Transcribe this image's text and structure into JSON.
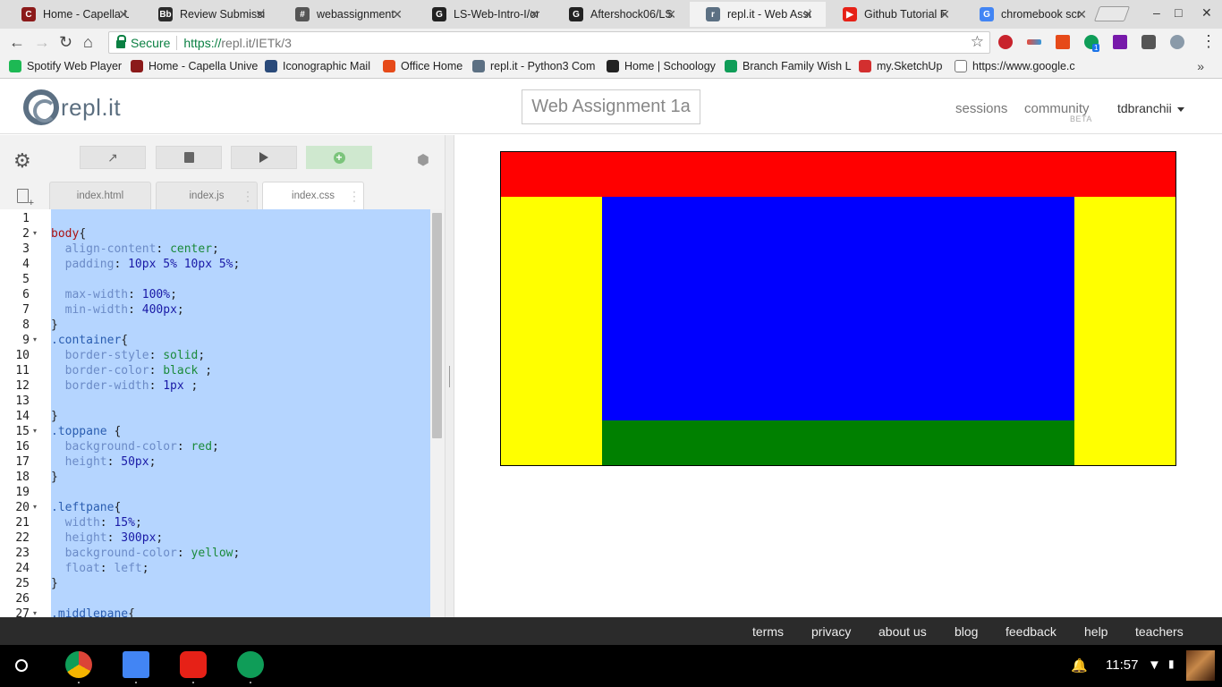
{
  "browser": {
    "tabs": [
      {
        "title": "Home - Capella U",
        "color": "#8b1a1a",
        "glyph": "C"
      },
      {
        "title": "Review Submissi",
        "color": "#2b2b2b",
        "glyph": "Bb"
      },
      {
        "title": "webassignment",
        "color": "#555555",
        "glyph": "#"
      },
      {
        "title": "LS-Web-Intro-I/or",
        "color": "#222222",
        "glyph": "G"
      },
      {
        "title": "Aftershock06/LS",
        "color": "#222222",
        "glyph": "G"
      },
      {
        "title": "repl.it - Web Assi",
        "color": "#5c7083",
        "glyph": "r"
      },
      {
        "title": "Github Tutorial F",
        "color": "#e62117",
        "glyph": "▶"
      },
      {
        "title": "chromebook scr",
        "color": "#4285f4",
        "glyph": "G"
      }
    ],
    "active_tab": 5,
    "address": {
      "secure_label": "Secure",
      "url_scheme": "https://",
      "url_rest": "repl.it/IETk/3"
    },
    "bookmarks": [
      {
        "label": "Spotify Web Player",
        "color": "#1db954"
      },
      {
        "label": "Home - Capella Unive",
        "color": "#8b1a1a"
      },
      {
        "label": "Iconographic Mail",
        "color": "#2a4a7a"
      },
      {
        "label": "Office Home",
        "color": "#e64a19"
      },
      {
        "label": "repl.it - Python3 Com",
        "color": "#5c7083"
      },
      {
        "label": "Home | Schoology",
        "color": "#222222"
      },
      {
        "label": "Branch Family Wish L",
        "color": "#0f9d58"
      },
      {
        "label": "my.SketchUp",
        "color": "#d32f2f"
      },
      {
        "label": "https://www.google.c",
        "color": "#ffffff"
      }
    ],
    "overflow_icon": "»",
    "extension_badge": "1"
  },
  "site": {
    "logo_text": "repl.it",
    "project_title": "Web Assignment 1a",
    "nav": {
      "sessions": "sessions",
      "community": "community",
      "community_badge": "BETA",
      "user": "tdbranchii"
    }
  },
  "editor": {
    "file_tabs": [
      "index.html",
      "index.js",
      "index.css"
    ],
    "active_file": 2,
    "lines": [
      {
        "n": "1",
        "fold": false,
        "tokens": []
      },
      {
        "n": "2",
        "fold": true,
        "tokens": [
          [
            "sel",
            "body"
          ],
          [
            "plain",
            "{"
          ]
        ]
      },
      {
        "n": "3",
        "fold": false,
        "tokens": [
          [
            "plain",
            "  "
          ],
          [
            "prop",
            "align-content"
          ],
          [
            "plain",
            ": "
          ],
          [
            "kw",
            "center"
          ],
          [
            "plain",
            ";"
          ]
        ]
      },
      {
        "n": "4",
        "fold": false,
        "tokens": [
          [
            "plain",
            "  "
          ],
          [
            "prop",
            "padding"
          ],
          [
            "plain",
            ": "
          ],
          [
            "num",
            "10px 5% 10px 5%"
          ],
          [
            "plain",
            ";"
          ]
        ]
      },
      {
        "n": "5",
        "fold": false,
        "tokens": []
      },
      {
        "n": "6",
        "fold": false,
        "tokens": [
          [
            "plain",
            "  "
          ],
          [
            "prop",
            "max-width"
          ],
          [
            "plain",
            ": "
          ],
          [
            "num",
            "100%"
          ],
          [
            "plain",
            ";"
          ]
        ]
      },
      {
        "n": "7",
        "fold": false,
        "tokens": [
          [
            "plain",
            "  "
          ],
          [
            "prop",
            "min-width"
          ],
          [
            "plain",
            ": "
          ],
          [
            "num",
            "400px"
          ],
          [
            "plain",
            ";"
          ]
        ]
      },
      {
        "n": "8",
        "fold": false,
        "tokens": [
          [
            "plain",
            "}"
          ]
        ]
      },
      {
        "n": "9",
        "fold": true,
        "tokens": [
          [
            "cls",
            ".container"
          ],
          [
            "plain",
            "{"
          ]
        ]
      },
      {
        "n": "10",
        "fold": false,
        "tokens": [
          [
            "plain",
            "  "
          ],
          [
            "prop",
            "border-style"
          ],
          [
            "plain",
            ": "
          ],
          [
            "kw",
            "solid"
          ],
          [
            "plain",
            ";"
          ]
        ]
      },
      {
        "n": "11",
        "fold": false,
        "tokens": [
          [
            "plain",
            "  "
          ],
          [
            "prop",
            "border-color"
          ],
          [
            "plain",
            ": "
          ],
          [
            "kw",
            "black"
          ],
          [
            "plain",
            " ;"
          ]
        ]
      },
      {
        "n": "12",
        "fold": false,
        "tokens": [
          [
            "plain",
            "  "
          ],
          [
            "prop",
            "border-width"
          ],
          [
            "plain",
            ": "
          ],
          [
            "num",
            "1px"
          ],
          [
            "plain",
            " ;"
          ]
        ]
      },
      {
        "n": "13",
        "fold": false,
        "tokens": []
      },
      {
        "n": "14",
        "fold": false,
        "tokens": [
          [
            "plain",
            "}"
          ]
        ]
      },
      {
        "n": "15",
        "fold": true,
        "tokens": [
          [
            "cls",
            ".toppane"
          ],
          [
            "plain",
            " {"
          ]
        ]
      },
      {
        "n": "16",
        "fold": false,
        "tokens": [
          [
            "plain",
            "  "
          ],
          [
            "prop",
            "background-color"
          ],
          [
            "plain",
            ": "
          ],
          [
            "kw",
            "red"
          ],
          [
            "plain",
            ";"
          ]
        ]
      },
      {
        "n": "17",
        "fold": false,
        "tokens": [
          [
            "plain",
            "  "
          ],
          [
            "prop",
            "height"
          ],
          [
            "plain",
            ": "
          ],
          [
            "num",
            "50px"
          ],
          [
            "plain",
            ";"
          ]
        ]
      },
      {
        "n": "18",
        "fold": false,
        "tokens": [
          [
            "plain",
            "}"
          ]
        ]
      },
      {
        "n": "19",
        "fold": false,
        "tokens": []
      },
      {
        "n": "20",
        "fold": true,
        "tokens": [
          [
            "cls",
            ".leftpane"
          ],
          [
            "plain",
            "{"
          ]
        ]
      },
      {
        "n": "21",
        "fold": false,
        "tokens": [
          [
            "plain",
            "  "
          ],
          [
            "prop",
            "width"
          ],
          [
            "plain",
            ": "
          ],
          [
            "num",
            "15%"
          ],
          [
            "plain",
            ";"
          ]
        ]
      },
      {
        "n": "22",
        "fold": false,
        "tokens": [
          [
            "plain",
            "  "
          ],
          [
            "prop",
            "height"
          ],
          [
            "plain",
            ": "
          ],
          [
            "num",
            "300px"
          ],
          [
            "plain",
            ";"
          ]
        ]
      },
      {
        "n": "23",
        "fold": false,
        "tokens": [
          [
            "plain",
            "  "
          ],
          [
            "prop",
            "background-color"
          ],
          [
            "plain",
            ": "
          ],
          [
            "kw",
            "yellow"
          ],
          [
            "plain",
            ";"
          ]
        ]
      },
      {
        "n": "24",
        "fold": false,
        "tokens": [
          [
            "plain",
            "  "
          ],
          [
            "prop",
            "float"
          ],
          [
            "plain",
            ": "
          ],
          [
            "prop",
            "left"
          ],
          [
            "plain",
            ";"
          ]
        ]
      },
      {
        "n": "25",
        "fold": false,
        "tokens": [
          [
            "plain",
            "}"
          ]
        ]
      },
      {
        "n": "26",
        "fold": false,
        "tokens": []
      },
      {
        "n": "27",
        "fold": true,
        "tokens": [
          [
            "cls",
            ".middlepane"
          ],
          [
            "plain",
            "{"
          ]
        ]
      }
    ]
  },
  "preview": {
    "colors": {
      "toppane": "#ff0000",
      "leftpane": "#ffff00",
      "middlepane": "#0000ff",
      "bottompane": "#008000",
      "rightpane": "#ffff00"
    }
  },
  "footer": {
    "links": [
      "terms",
      "privacy",
      "about us",
      "blog",
      "feedback",
      "help",
      "teachers"
    ]
  },
  "shelf": {
    "apps": [
      {
        "name": "chrome-app-icon",
        "color": "#4285f4"
      },
      {
        "name": "docs-app-icon",
        "color": "#4285f4"
      },
      {
        "name": "youtube-app-icon",
        "color": "#e62117"
      },
      {
        "name": "hangouts-app-icon",
        "color": "#0f9d58"
      }
    ],
    "clock": "11:57"
  }
}
